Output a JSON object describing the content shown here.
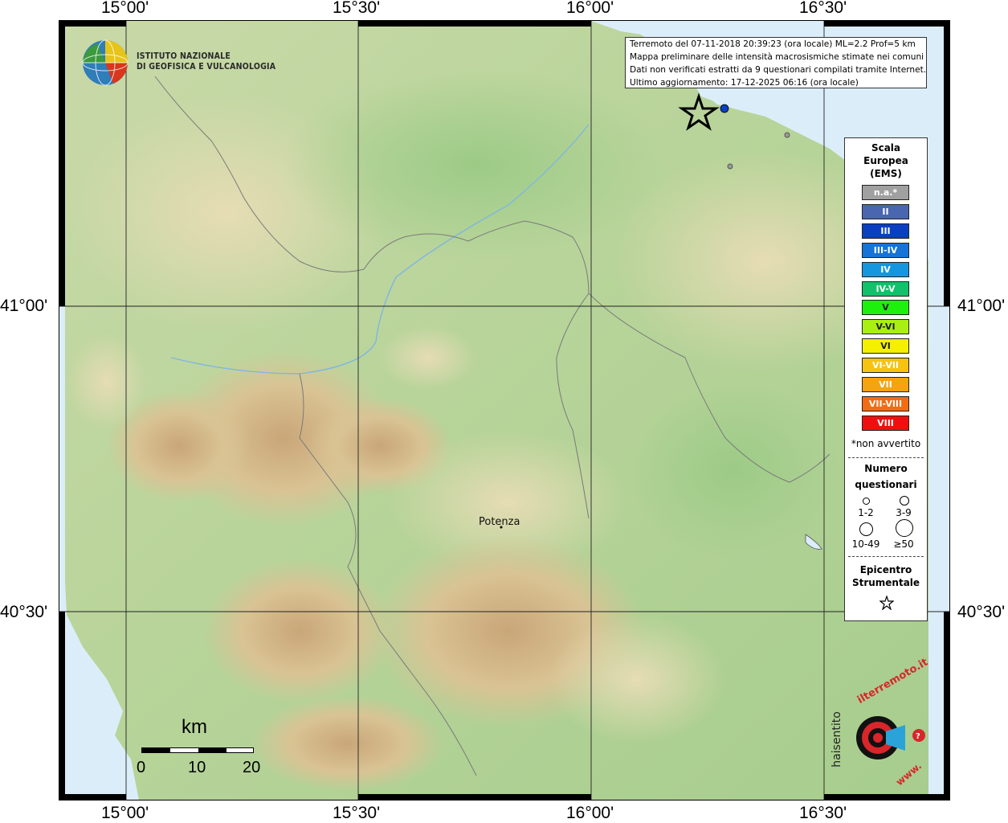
{
  "coordinates": {
    "lon_top": [
      "15°00'",
      "15°30'",
      "16°00'",
      "16°30'"
    ],
    "lon_bottom": [
      "15°00'",
      "15°30'",
      "16°00'",
      "16°30'"
    ],
    "lat_left": [
      "41°00'",
      "40°30'"
    ],
    "lat_right": [
      "41°00'",
      "40°30'"
    ]
  },
  "institute": {
    "line1": "ISTITUTO NAZIONALE",
    "line2": "DI GEOFISICA E VULCANOLOGIA"
  },
  "info": {
    "line1": "Terremoto del 07-11-2018 20:39:23 (ora locale) ML=2.2 Prof=5 km",
    "line2": "Mappa preliminare delle intensità macrosismiche stimate nei comuni",
    "line3": "Dati non verificati estratti da 9 questionari compilati tramite Internet.",
    "line4": "Ultimo aggiornamento: 17-12-2025 06:16 (ora locale)"
  },
  "legend": {
    "title1": "Scala",
    "title2": "Europea",
    "title3": "(EMS)",
    "scale": [
      {
        "label": "n.a.*",
        "color": "#a0a0a0"
      },
      {
        "label": "II",
        "color": "#4a66b0"
      },
      {
        "label": "III",
        "color": "#0a3fc0"
      },
      {
        "label": "III-IV",
        "color": "#1673d8"
      },
      {
        "label": "IV",
        "color": "#1597e0"
      },
      {
        "label": "IV-V",
        "color": "#12c16a"
      },
      {
        "label": "V",
        "color": "#1ef00e"
      },
      {
        "label": "V-VI",
        "color": "#a9f012"
      },
      {
        "label": "VI",
        "color": "#f4f000"
      },
      {
        "label": "VI-VII",
        "color": "#f6c310"
      },
      {
        "label": "VII",
        "color": "#f6a30e"
      },
      {
        "label": "VII-VIII",
        "color": "#f36c12"
      },
      {
        "label": "VIII",
        "color": "#ee1010"
      }
    ],
    "non_avvertito": "*non avvertito",
    "numero": "Numero",
    "questionari": "questionari",
    "sizes": [
      "1-2",
      "3-9",
      "10-49",
      "≥50"
    ],
    "epicentro1": "Epicentro",
    "epicentro2": "Strumentale"
  },
  "scale_bar": {
    "unit": "km",
    "ticks": [
      "0",
      "10",
      "20"
    ]
  },
  "place": {
    "name": "Potenza"
  },
  "haisentito": {
    "text1": "haisentito",
    "text2": "ilterremoto.it",
    "text3": "www."
  }
}
